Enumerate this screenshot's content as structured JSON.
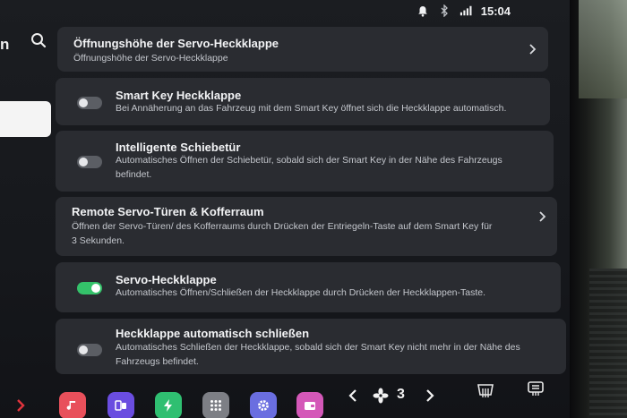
{
  "statusbar": {
    "time": "15:04",
    "icons": [
      "bell-icon",
      "bluetooth-icon",
      "signal-icon"
    ]
  },
  "left": {
    "title_fragment": "n"
  },
  "cards": [
    {
      "title": "Öffnungshöhe der Servo-Heckklappe",
      "desc": "Öffnungshöhe der Servo-Heckklappe",
      "type": "link"
    },
    {
      "title": "Smart Key Heckklappe",
      "desc": "Bei Annäherung an das Fahrzeug mit dem Smart Key öffnet sich die Heckklappe automatisch.",
      "type": "toggle",
      "on": false
    },
    {
      "title": "Intelligente Schiebetür",
      "desc": "Automatisches Öffnen der Schiebetür, sobald sich der Smart Key in der Nähe des Fahrzeugs befindet.",
      "type": "toggle",
      "on": false
    },
    {
      "title": "Remote Servo-Türen & Kofferraum",
      "desc": "Öffnen der Servo-Türen/ des Kofferraums durch Drücken der Entriegeln-Taste auf dem Smart Key für 3 Sekunden.",
      "type": "link"
    },
    {
      "title": "Servo-Heckklappe",
      "desc": "Automatisches Öffnen/Schließen der Heckklappe durch Drücken der Heckklappen-Taste.",
      "type": "toggle",
      "on": true
    },
    {
      "title": "Heckklappe automatisch schließen",
      "desc": "Automatisches Schließen der Heckklappe, sobald sich der Smart Key nicht mehr in der Nähe des Fahrzeugs befindet.",
      "type": "toggle",
      "on": false
    }
  ],
  "dock": {
    "apps": [
      {
        "name": "music-app",
        "color": "#e8505b"
      },
      {
        "name": "phone-link-app",
        "color": "#6a4de0"
      },
      {
        "name": "energy-app",
        "color": "#2fbf71"
      },
      {
        "name": "app-grid",
        "color": "#8a8c92"
      },
      {
        "name": "settings-app",
        "color": "#6a6ee0"
      },
      {
        "name": "wallet-app",
        "color": "#d458b8"
      }
    ],
    "fan_level": "3"
  },
  "colors": {
    "accent_green": "#34c26a",
    "card": "#2a2c31"
  }
}
